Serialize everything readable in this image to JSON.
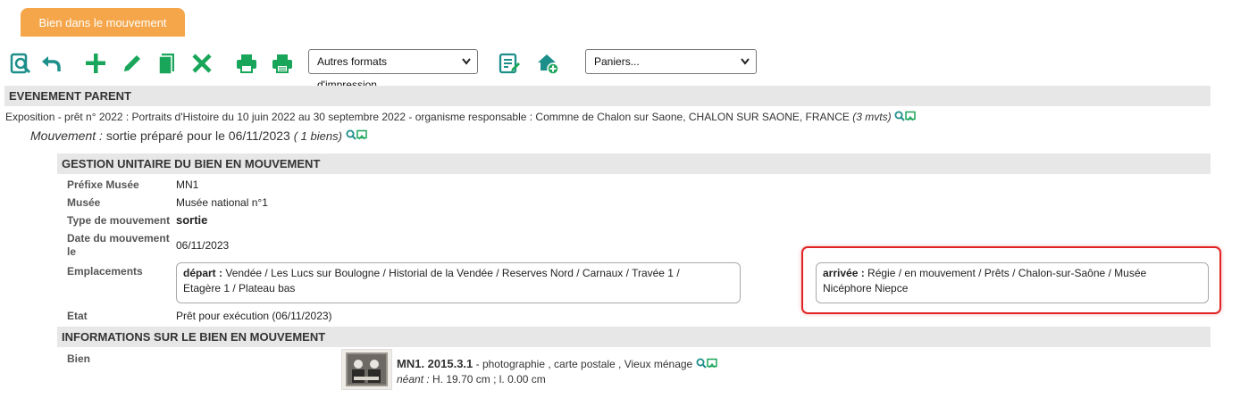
{
  "tab": {
    "label": "Bien dans le mouvement"
  },
  "toolbar": {
    "icons": [
      "preview-icon",
      "back-icon",
      "add-icon",
      "edit-icon",
      "copy-icon",
      "delete-icon",
      "print-icon",
      "print-alt-icon",
      "report-icon",
      "home-add-icon"
    ],
    "print_select": "Autres formats d'impression...",
    "basket_select": "Paniers..."
  },
  "evenement_parent": {
    "heading": "EVENEMENT PARENT",
    "description": "Exposition - prêt n° 2022 : Portraits d'Histoire du 10 juin 2022 au 30 septembre 2022 - organisme responsable : Commne de Chalon sur Saone, CHALON SUR SAONE, FRANCE",
    "count": "3 mvts",
    "mouvement_label": "Mouvement :",
    "mouvement_text": "sortie préparé pour le 06/11/2023",
    "mouvement_count": "1 biens"
  },
  "gestion": {
    "heading": "GESTION UNITAIRE DU BIEN EN MOUVEMENT",
    "prefixe_label": "Préfixe Musée",
    "prefixe_value": "MN1",
    "musee_label": "Musée",
    "musee_value": "Musée national n°1",
    "type_label": "Type de mouvement",
    "type_value": "sortie",
    "date_label": "Date du mouvement",
    "date_label_2": "le",
    "date_value": "06/11/2023",
    "emplacements_label": "Emplacements",
    "depart_label": "départ :",
    "depart_line1": "Vendée / Les Lucs sur Boulogne / Historial de la Vendée / Reserves Nord / Carnaux / Travée 1 /",
    "depart_line2": "Etagère 1 / Plateau bas",
    "arrivee_label": "arrivée :",
    "arrivee_line1": "Régie / en mouvement / Prêts / Chalon-sur-Saône / Musée",
    "arrivee_line2": "Nicéphore Niepce",
    "etat_label": "Etat",
    "etat_value": "Prêt pour exécution (06/11/2023)"
  },
  "informations": {
    "heading": "INFORMATIONS SUR LE BIEN EN MOUVEMENT",
    "bien_label": "Bien",
    "bien_id": "MN1. 2015.3.1",
    "bien_desc": "- photographie , carte postale , Vieux ménage",
    "dims_prefix": "néant :",
    "dims_value": "H. 19.70 cm ;  l. 0.00 cm"
  },
  "colors": {
    "accent": "#f5a64a",
    "icon_teal": "#2a9d8f",
    "icon_green": "#1aa65a",
    "highlight": "#e02424"
  }
}
